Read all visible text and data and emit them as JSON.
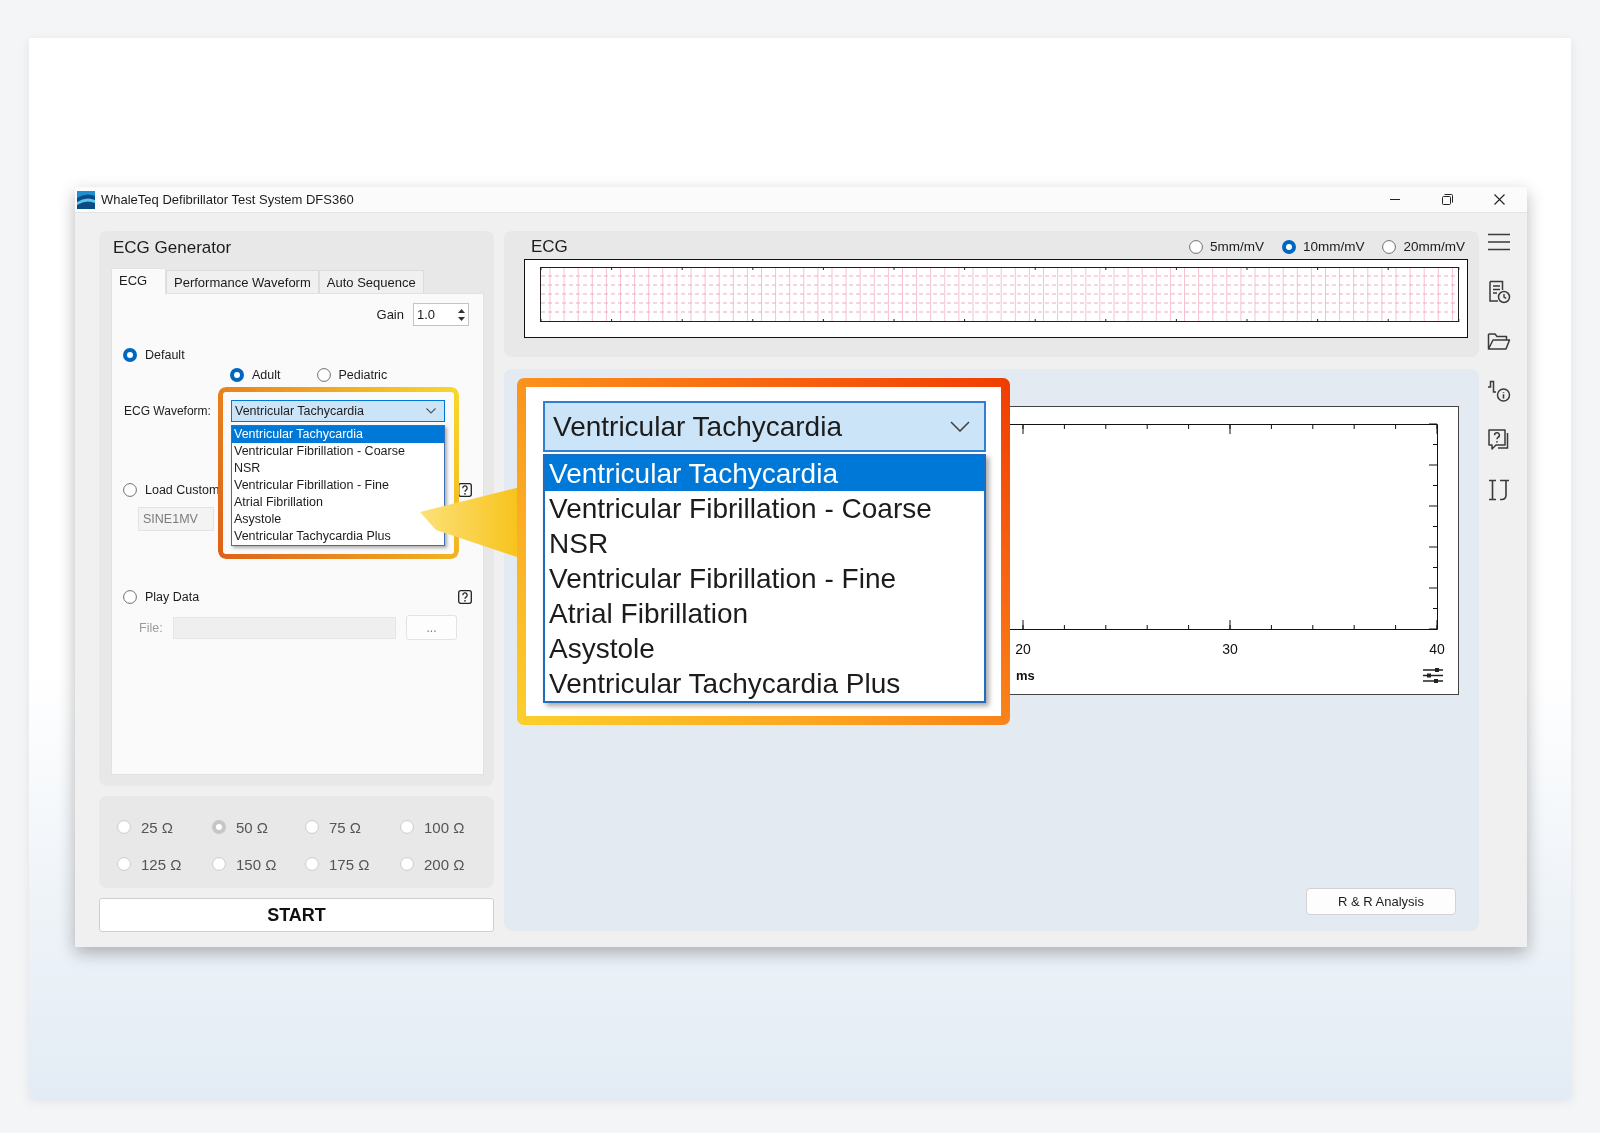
{
  "window": {
    "title": "WhaleTeq Defibrillator Test System DFS360"
  },
  "ecg_generator": {
    "title": "ECG Generator",
    "tabs": [
      {
        "label": "ECG",
        "selected": true
      },
      {
        "label": "Performance Waveform",
        "selected": false
      },
      {
        "label": "Auto Sequence",
        "selected": false
      }
    ],
    "gain": {
      "label": "Gain",
      "value": "1.0"
    },
    "default_option": {
      "label": "Default",
      "selected": true
    },
    "patient_types": [
      {
        "label": "Adult",
        "selected": true
      },
      {
        "label": "Pediatric",
        "selected": false
      }
    ],
    "ecg_waveform": {
      "label": "ECG Waveform:",
      "value": "Ventricular Tachycardia",
      "expanded": true,
      "options": [
        {
          "label": "Ventricular Tachycardia",
          "selected": true
        },
        {
          "label": "Ventricular Fibrillation - Coarse",
          "selected": false
        },
        {
          "label": "NSR",
          "selected": false
        },
        {
          "label": "Ventricular Fibrillation - Fine",
          "selected": false
        },
        {
          "label": "Atrial Fibrillation",
          "selected": false
        },
        {
          "label": "Asystole",
          "selected": false
        },
        {
          "label": "Ventricular Tachycardia Plus",
          "selected": false
        }
      ]
    },
    "load_custom": {
      "label": "Load Custom",
      "selected": false,
      "file": {
        "value": "SINE1MV",
        "disabled": true
      }
    },
    "play_data": {
      "label": "Play Data",
      "selected": false,
      "file_label": "File:",
      "file": {
        "disabled": true
      },
      "browse_button": {
        "label": "...",
        "disabled": true
      }
    }
  },
  "resistance": {
    "disabled": true,
    "options": [
      {
        "label": "25 Ω",
        "selected": false
      },
      {
        "label": "50 Ω",
        "selected": true
      },
      {
        "label": "75 Ω",
        "selected": false
      },
      {
        "label": "100 Ω",
        "selected": false
      },
      {
        "label": "125 Ω",
        "selected": false
      },
      {
        "label": "150 Ω",
        "selected": false
      },
      {
        "label": "175 Ω",
        "selected": false
      },
      {
        "label": "200 Ω",
        "selected": false
      }
    ]
  },
  "start_button": {
    "label": "START"
  },
  "ecg_view": {
    "title": "ECG",
    "scales": [
      {
        "label": "5mm/mV",
        "selected": false
      },
      {
        "label": "10mm/mV",
        "selected": true
      },
      {
        "label": "20mm/mV",
        "selected": false
      }
    ]
  },
  "zoom_callout": {
    "value": "Ventricular Tachycardia",
    "expanded": true,
    "options": [
      {
        "label": "Ventricular Tachycardia",
        "selected": true
      },
      {
        "label": "Ventricular Fibrillation - Coarse",
        "selected": false
      },
      {
        "label": "NSR",
        "selected": false
      },
      {
        "label": "Ventricular Fibrillation - Fine",
        "selected": false
      },
      {
        "label": "Atrial Fibrillation",
        "selected": false
      },
      {
        "label": "Asystole",
        "selected": false
      },
      {
        "label": "Ventricular Tachycardia Plus",
        "selected": false
      }
    ]
  },
  "plot": {
    "x_tick_labels": [
      "20",
      "30",
      "40"
    ],
    "x_axis_label": "ms"
  },
  "rr_analysis_button": {
    "label": "R & R Analysis"
  }
}
